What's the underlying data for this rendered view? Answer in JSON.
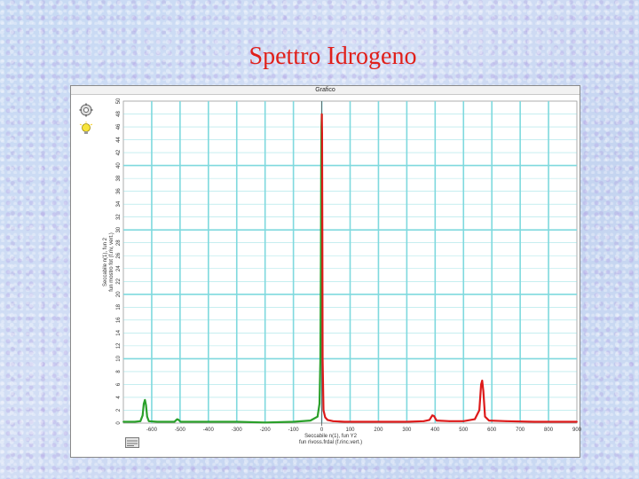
{
  "slide": {
    "title": "Spettro Idrogeno"
  },
  "window": {
    "title": "Grafico"
  },
  "icons": {
    "settings": "gear-icon",
    "idea": "lightbulb-icon",
    "graph_toggle": "graph-toggle-icon"
  },
  "colors": {
    "grid": "#7fd9de",
    "left_series": "#2aa02a",
    "right_series": "#dd1a1a",
    "title": "#e0201a"
  },
  "chart_data": {
    "type": "line",
    "ylabel": "Seccabile n(1), fun 2",
    "ylabel2": "fun mostro fot (f.riv, vert.)",
    "xlabel": "Seccabile n(1), fun Y2",
    "xlabel2": "fun rivoss.frdal (f.rinc.vert.)",
    "ylim": [
      0,
      50
    ],
    "y_ticks": [
      "50",
      "48",
      "46",
      "44",
      "42",
      "40",
      "38",
      "36",
      "34",
      "32",
      "30",
      "28",
      "26",
      "24",
      "22",
      "20",
      "18",
      "16",
      "14",
      "12",
      "10",
      "8",
      "6",
      "4",
      "2",
      "0"
    ],
    "x_ticks": [
      "700",
      "650",
      "-600",
      "-550",
      "-500",
      "-450",
      "-400",
      "-350",
      "-300",
      "-250",
      "-200",
      "-150",
      "-100",
      "-50",
      "0",
      "50",
      "100",
      "150",
      "200",
      "250",
      "300",
      "350",
      "400",
      "450",
      "500",
      "550",
      "600",
      "650",
      "700",
      "750",
      "800",
      "850",
      "900"
    ],
    "left_tick_labels": [
      "-700",
      "-650",
      "-600",
      "-550",
      "-500",
      "-450",
      "-400",
      "-350",
      "-300",
      "-250",
      "-200",
      "-150",
      "-100",
      "-50",
      "0"
    ],
    "right_tick_labels": [
      "50",
      "100",
      "150",
      "200",
      "250",
      "300",
      "350",
      "400",
      "450",
      "500",
      "550",
      "600",
      "650",
      "700",
      "750",
      "800",
      "850",
      "900"
    ],
    "series": [
      {
        "name": "",
        "color": "#2aa02a",
        "points": [
          [
            -700,
            0.2
          ],
          [
            -660,
            0.2
          ],
          [
            -640,
            0.3
          ],
          [
            -632,
            1.2
          ],
          [
            -628,
            3.0
          ],
          [
            -624,
            3.6
          ],
          [
            -620,
            2.8
          ],
          [
            -616,
            1.0
          ],
          [
            -610,
            0.3
          ],
          [
            -580,
            0.2
          ],
          [
            -520,
            0.2
          ],
          [
            -510,
            0.6
          ],
          [
            -505,
            0.5
          ],
          [
            -498,
            0.2
          ],
          [
            -400,
            0.2
          ],
          [
            -300,
            0.2
          ],
          [
            -200,
            0.1
          ],
          [
            -100,
            0.2
          ],
          [
            -40,
            0.4
          ],
          [
            -15,
            1.0
          ],
          [
            -8,
            3.0
          ],
          [
            -5,
            10
          ],
          [
            -3,
            26
          ],
          [
            -2,
            40
          ],
          [
            -1,
            46
          ],
          [
            0,
            48
          ]
        ]
      },
      {
        "name": "",
        "color": "#dd1a1a",
        "points": [
          [
            0,
            48
          ],
          [
            1,
            45
          ],
          [
            2,
            30
          ],
          [
            3,
            10
          ],
          [
            6,
            2.0
          ],
          [
            12,
            0.9
          ],
          [
            20,
            0.5
          ],
          [
            40,
            0.3
          ],
          [
            80,
            0.2
          ],
          [
            200,
            0.2
          ],
          [
            300,
            0.2
          ],
          [
            360,
            0.3
          ],
          [
            380,
            0.5
          ],
          [
            390,
            1.2
          ],
          [
            396,
            1.1
          ],
          [
            405,
            0.4
          ],
          [
            450,
            0.3
          ],
          [
            500,
            0.3
          ],
          [
            540,
            0.6
          ],
          [
            556,
            2.0
          ],
          [
            562,
            6.0
          ],
          [
            566,
            6.6
          ],
          [
            570,
            5.0
          ],
          [
            576,
            1.0
          ],
          [
            590,
            0.4
          ],
          [
            650,
            0.3
          ],
          [
            750,
            0.2
          ],
          [
            900,
            0.2
          ]
        ]
      }
    ]
  }
}
